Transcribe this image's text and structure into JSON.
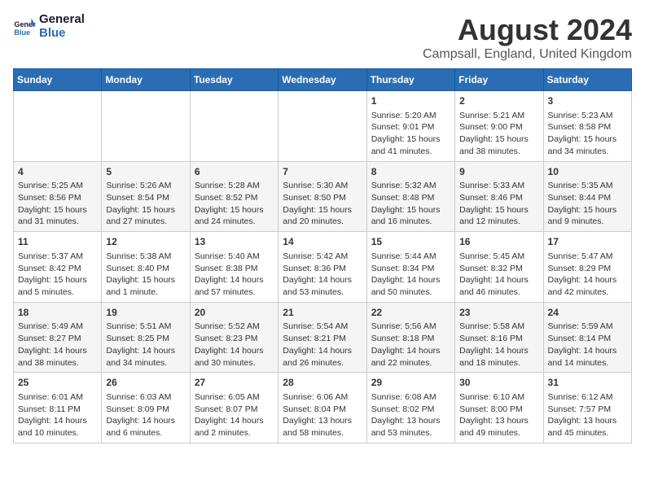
{
  "header": {
    "logo_line1": "General",
    "logo_line2": "Blue",
    "main_title": "August 2024",
    "subtitle": "Campsall, England, United Kingdom"
  },
  "days_of_week": [
    "Sunday",
    "Monday",
    "Tuesday",
    "Wednesday",
    "Thursday",
    "Friday",
    "Saturday"
  ],
  "weeks": [
    [
      {
        "day": "",
        "text": ""
      },
      {
        "day": "",
        "text": ""
      },
      {
        "day": "",
        "text": ""
      },
      {
        "day": "",
        "text": ""
      },
      {
        "day": "1",
        "text": "Sunrise: 5:20 AM\nSunset: 9:01 PM\nDaylight: 15 hours\nand 41 minutes."
      },
      {
        "day": "2",
        "text": "Sunrise: 5:21 AM\nSunset: 9:00 PM\nDaylight: 15 hours\nand 38 minutes."
      },
      {
        "day": "3",
        "text": "Sunrise: 5:23 AM\nSunset: 8:58 PM\nDaylight: 15 hours\nand 34 minutes."
      }
    ],
    [
      {
        "day": "4",
        "text": "Sunrise: 5:25 AM\nSunset: 8:56 PM\nDaylight: 15 hours\nand 31 minutes."
      },
      {
        "day": "5",
        "text": "Sunrise: 5:26 AM\nSunset: 8:54 PM\nDaylight: 15 hours\nand 27 minutes."
      },
      {
        "day": "6",
        "text": "Sunrise: 5:28 AM\nSunset: 8:52 PM\nDaylight: 15 hours\nand 24 minutes."
      },
      {
        "day": "7",
        "text": "Sunrise: 5:30 AM\nSunset: 8:50 PM\nDaylight: 15 hours\nand 20 minutes."
      },
      {
        "day": "8",
        "text": "Sunrise: 5:32 AM\nSunset: 8:48 PM\nDaylight: 15 hours\nand 16 minutes."
      },
      {
        "day": "9",
        "text": "Sunrise: 5:33 AM\nSunset: 8:46 PM\nDaylight: 15 hours\nand 12 minutes."
      },
      {
        "day": "10",
        "text": "Sunrise: 5:35 AM\nSunset: 8:44 PM\nDaylight: 15 hours\nand 9 minutes."
      }
    ],
    [
      {
        "day": "11",
        "text": "Sunrise: 5:37 AM\nSunset: 8:42 PM\nDaylight: 15 hours\nand 5 minutes."
      },
      {
        "day": "12",
        "text": "Sunrise: 5:38 AM\nSunset: 8:40 PM\nDaylight: 15 hours\nand 1 minute."
      },
      {
        "day": "13",
        "text": "Sunrise: 5:40 AM\nSunset: 8:38 PM\nDaylight: 14 hours\nand 57 minutes."
      },
      {
        "day": "14",
        "text": "Sunrise: 5:42 AM\nSunset: 8:36 PM\nDaylight: 14 hours\nand 53 minutes."
      },
      {
        "day": "15",
        "text": "Sunrise: 5:44 AM\nSunset: 8:34 PM\nDaylight: 14 hours\nand 50 minutes."
      },
      {
        "day": "16",
        "text": "Sunrise: 5:45 AM\nSunset: 8:32 PM\nDaylight: 14 hours\nand 46 minutes."
      },
      {
        "day": "17",
        "text": "Sunrise: 5:47 AM\nSunset: 8:29 PM\nDaylight: 14 hours\nand 42 minutes."
      }
    ],
    [
      {
        "day": "18",
        "text": "Sunrise: 5:49 AM\nSunset: 8:27 PM\nDaylight: 14 hours\nand 38 minutes."
      },
      {
        "day": "19",
        "text": "Sunrise: 5:51 AM\nSunset: 8:25 PM\nDaylight: 14 hours\nand 34 minutes."
      },
      {
        "day": "20",
        "text": "Sunrise: 5:52 AM\nSunset: 8:23 PM\nDaylight: 14 hours\nand 30 minutes."
      },
      {
        "day": "21",
        "text": "Sunrise: 5:54 AM\nSunset: 8:21 PM\nDaylight: 14 hours\nand 26 minutes."
      },
      {
        "day": "22",
        "text": "Sunrise: 5:56 AM\nSunset: 8:18 PM\nDaylight: 14 hours\nand 22 minutes."
      },
      {
        "day": "23",
        "text": "Sunrise: 5:58 AM\nSunset: 8:16 PM\nDaylight: 14 hours\nand 18 minutes."
      },
      {
        "day": "24",
        "text": "Sunrise: 5:59 AM\nSunset: 8:14 PM\nDaylight: 14 hours\nand 14 minutes."
      }
    ],
    [
      {
        "day": "25",
        "text": "Sunrise: 6:01 AM\nSunset: 8:11 PM\nDaylight: 14 hours\nand 10 minutes."
      },
      {
        "day": "26",
        "text": "Sunrise: 6:03 AM\nSunset: 8:09 PM\nDaylight: 14 hours\nand 6 minutes."
      },
      {
        "day": "27",
        "text": "Sunrise: 6:05 AM\nSunset: 8:07 PM\nDaylight: 14 hours\nand 2 minutes."
      },
      {
        "day": "28",
        "text": "Sunrise: 6:06 AM\nSunset: 8:04 PM\nDaylight: 13 hours\nand 58 minutes."
      },
      {
        "day": "29",
        "text": "Sunrise: 6:08 AM\nSunset: 8:02 PM\nDaylight: 13 hours\nand 53 minutes."
      },
      {
        "day": "30",
        "text": "Sunrise: 6:10 AM\nSunset: 8:00 PM\nDaylight: 13 hours\nand 49 minutes."
      },
      {
        "day": "31",
        "text": "Sunrise: 6:12 AM\nSunset: 7:57 PM\nDaylight: 13 hours\nand 45 minutes."
      }
    ]
  ]
}
